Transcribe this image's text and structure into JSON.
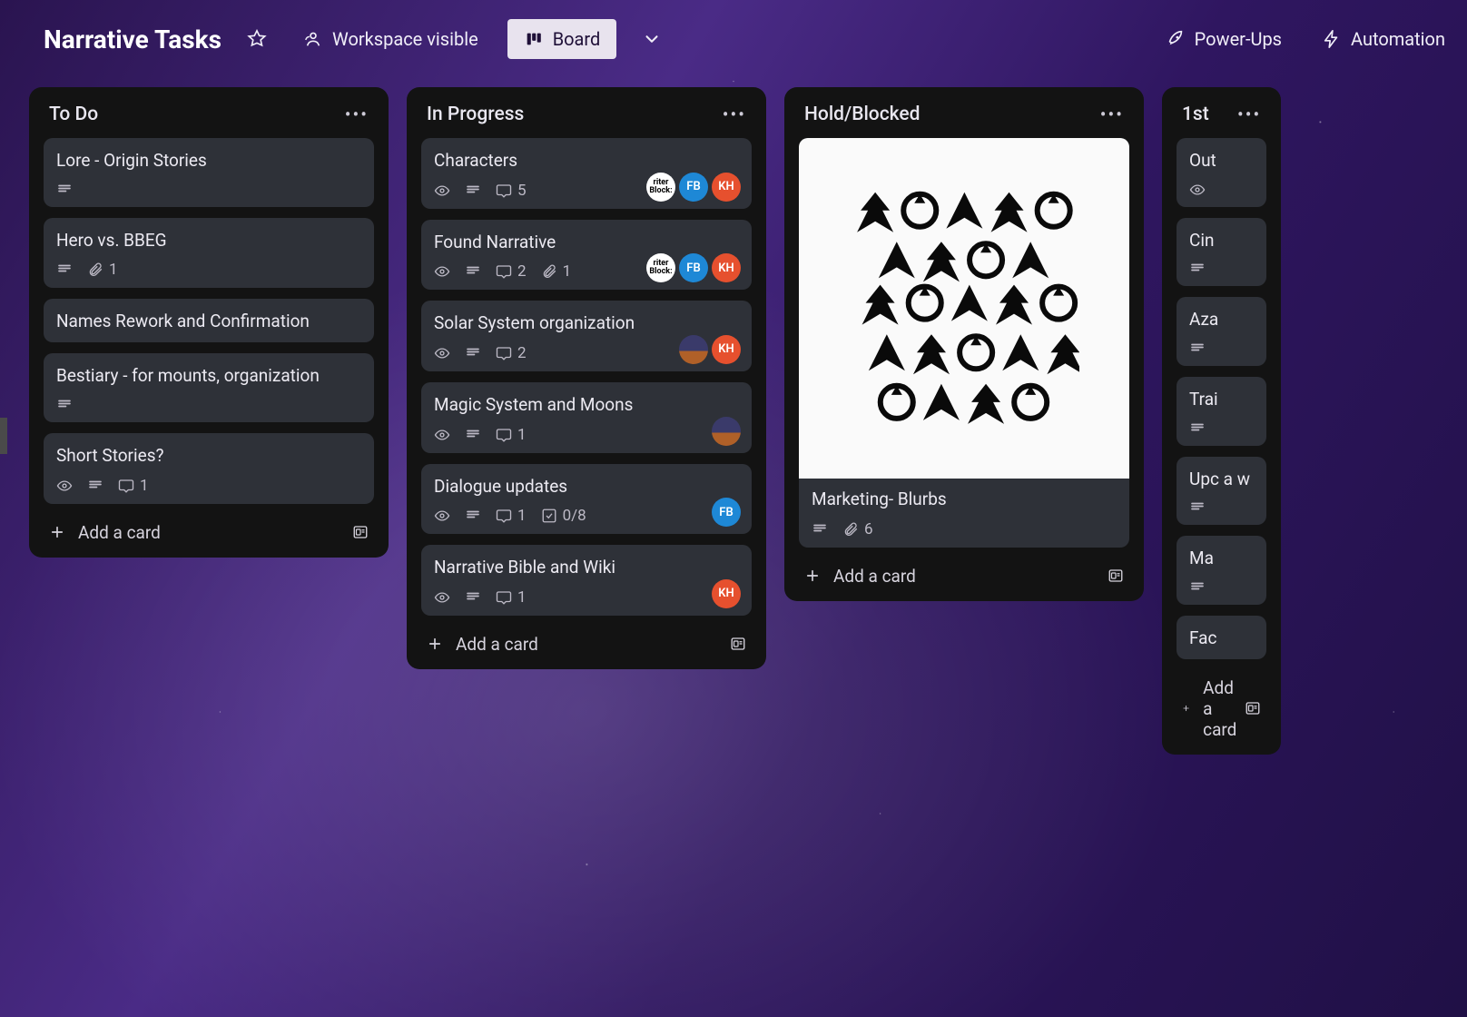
{
  "header": {
    "title": "Narrative Tasks",
    "visibility_label": "Workspace visible",
    "view_label": "Board",
    "powerups_label": "Power-Ups",
    "automation_label": "Automation"
  },
  "icons": {
    "star": "star",
    "people": "people",
    "board": "board",
    "chevron_down": "chevron-down",
    "rocket": "rocket",
    "bolt": "bolt",
    "more": "•••",
    "plus": "+",
    "eye": "eye",
    "description": "description",
    "comment": "comment",
    "attachment": "attachment",
    "checklist": "checklist",
    "template": "template"
  },
  "avatars": {
    "FB": "FB",
    "KH": "KH"
  },
  "lists": [
    {
      "title": "To Do",
      "add_label": "Add a card",
      "cards": [
        {
          "title": "Lore - Origin Stories",
          "description": true
        },
        {
          "title": "Hero vs. BBEG",
          "description": true,
          "attachments": 1
        },
        {
          "title": "Names Rework and Confirmation"
        },
        {
          "title": "Bestiary - for mounts, organization",
          "description": true
        },
        {
          "title": "Short Stories?",
          "watch": true,
          "description": true,
          "comments": 1
        }
      ]
    },
    {
      "title": "In Progress",
      "add_label": "Add a card",
      "cards": [
        {
          "title": "Characters",
          "watch": true,
          "description": true,
          "comments": 5,
          "members": [
            "img1",
            "FB",
            "KH"
          ]
        },
        {
          "title": "Found Narrative",
          "watch": true,
          "description": true,
          "comments": 2,
          "attachments": 1,
          "members": [
            "img1",
            "FB",
            "KH"
          ]
        },
        {
          "title": "Solar System organization",
          "watch": true,
          "description": true,
          "comments": 2,
          "members": [
            "img2",
            "KH"
          ]
        },
        {
          "title": "Magic System and Moons",
          "watch": true,
          "description": true,
          "comments": 1,
          "members": [
            "img2"
          ]
        },
        {
          "title": "Dialogue updates",
          "watch": true,
          "description": true,
          "comments": 1,
          "checklist": "0/8",
          "members": [
            "FB"
          ]
        },
        {
          "title": "Narrative Bible and Wiki",
          "watch": true,
          "description": true,
          "comments": 1,
          "members": [
            "KH"
          ]
        }
      ]
    },
    {
      "title": "Hold/Blocked",
      "add_label": "Add a card",
      "cards": [
        {
          "title": "Marketing- Blurbs",
          "description": true,
          "attachments": 6,
          "cover": true
        }
      ]
    },
    {
      "title": "1st",
      "add_label": "Add a card",
      "cards": [
        {
          "title": "Out",
          "watch": true
        },
        {
          "title": "Cin",
          "description": true
        },
        {
          "title": "Aza",
          "description": true
        },
        {
          "title": "Trai",
          "description": true
        },
        {
          "title": "Upc a w",
          "description": true
        },
        {
          "title": "Ma",
          "description": true
        },
        {
          "title": "Fac"
        }
      ]
    }
  ]
}
